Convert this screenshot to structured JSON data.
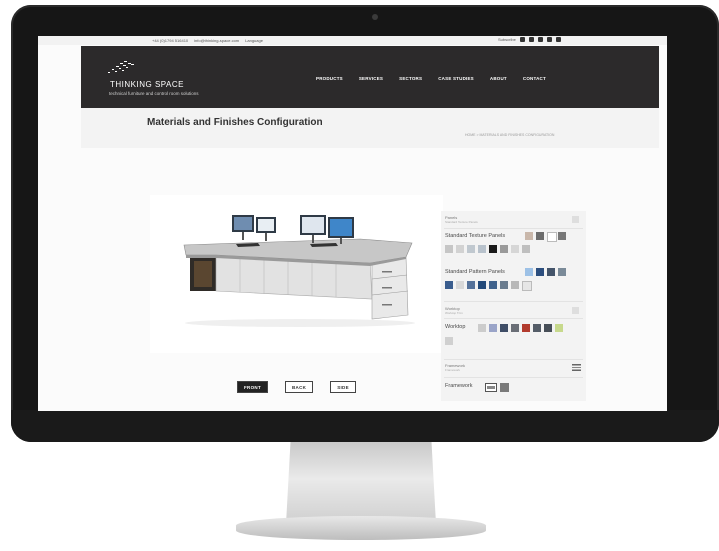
{
  "topbar": {
    "phone": "+44 (0)1794 516410",
    "email": "info@thinking-space.com",
    "language": "Language",
    "subscribe": "Subscribe"
  },
  "header": {
    "brand": "THINKING SPACE",
    "tagline": "technical furniture and control room solutions",
    "nav": [
      "PRODUCTS",
      "SERVICES",
      "SECTORS",
      "CASE STUDIES",
      "ABOUT",
      "CONTACT"
    ]
  },
  "page": {
    "title": "Materials and Finishes Configuration",
    "breadcrumb": "HOME > MATERIALS AND FINISHES CONFIGURATION"
  },
  "view_buttons": [
    "FRONT",
    "BACK",
    "SIDE"
  ],
  "config": {
    "panels_label": "Panels",
    "panels_sub": "Standard Texture Panels",
    "texture_head": "Standard Texture Panels",
    "pattern_head": "Standard Pattern Panels",
    "worktop_label": "Worktop",
    "worktop_sub": "Worktop Trim",
    "worktop_head": "Worktop",
    "framework_label": "Framework",
    "framework_sub": "Framework",
    "framework_head": "Framework",
    "texture_colors_row1": [
      "#c9b7aa",
      "#6c6c6c",
      "#ffffff",
      "#777777"
    ],
    "texture_colors_row2": [
      "#c6c6c6",
      "#d2d2d2",
      "#c0c8cf",
      "#b8c2cc",
      "#1a1a1a",
      "#9a9a9a",
      "#d6d6d6",
      "#bfbfbf"
    ],
    "pattern_colors_row1": [
      "#9dc1e6",
      "#2c4e7e",
      "#44546a",
      "#7a8a98"
    ],
    "pattern_colors_row2": [
      "#3a5d8e",
      "#d8d8d8",
      "#55729a",
      "#234a7a",
      "#40628c",
      "#6a7c8e",
      "#b8b8b8",
      "#e6e6e6"
    ],
    "worktop_colors": [
      "#cccccc",
      "#9aa4c8",
      "#3f4d66",
      "#6a6e76",
      "#b23b2e",
      "#555d68",
      "#474e57",
      "#c7d98c"
    ],
    "worktop_extra": [
      "#d0d0d0"
    ]
  }
}
